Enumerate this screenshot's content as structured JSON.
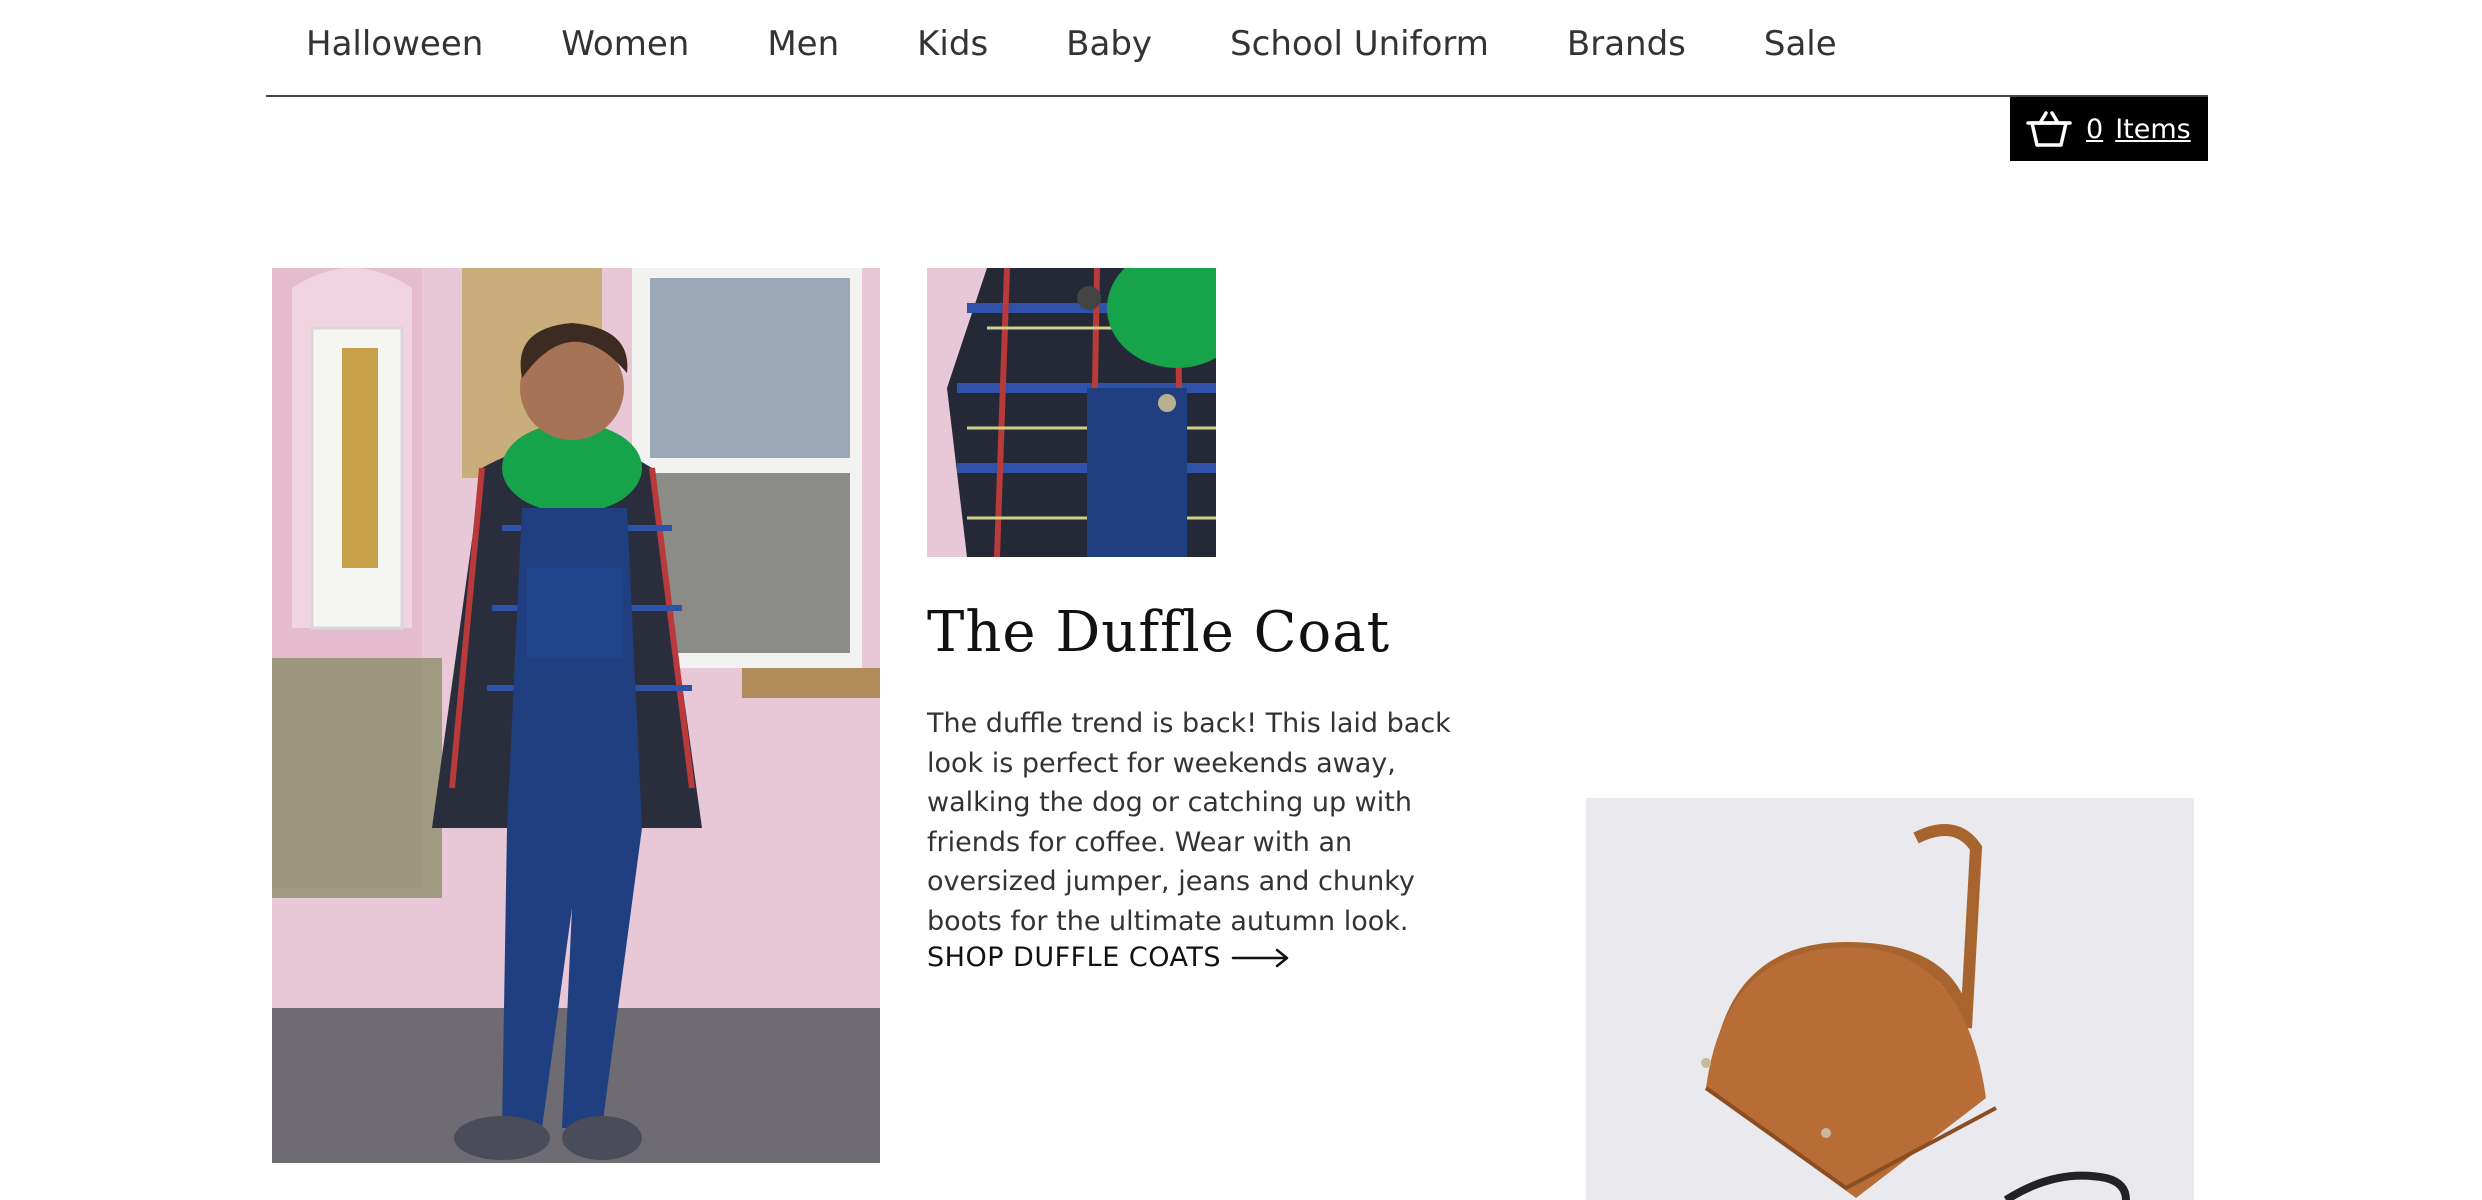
{
  "nav": {
    "items": [
      "Halloween",
      "Women",
      "Men",
      "Kids",
      "Baby",
      "School Uniform",
      "Brands",
      "Sale"
    ]
  },
  "cart": {
    "count": "0",
    "label": "Items",
    "icon": "basket-icon"
  },
  "feature": {
    "title": "The Duffle Coat",
    "description": "The duffle trend is back! This laid back look is perfect for weekends away, walking the dog or catching up with friends for coffee. Wear with an oversized jumper, jeans and chunky boots for the ultimate autumn look.",
    "cta": "SHOP DUFFLE COATS",
    "cta_icon": "arrow-right-icon"
  },
  "colors": {
    "cart_bg": "#000000",
    "nav_border": "#444444",
    "text": "#333333"
  }
}
